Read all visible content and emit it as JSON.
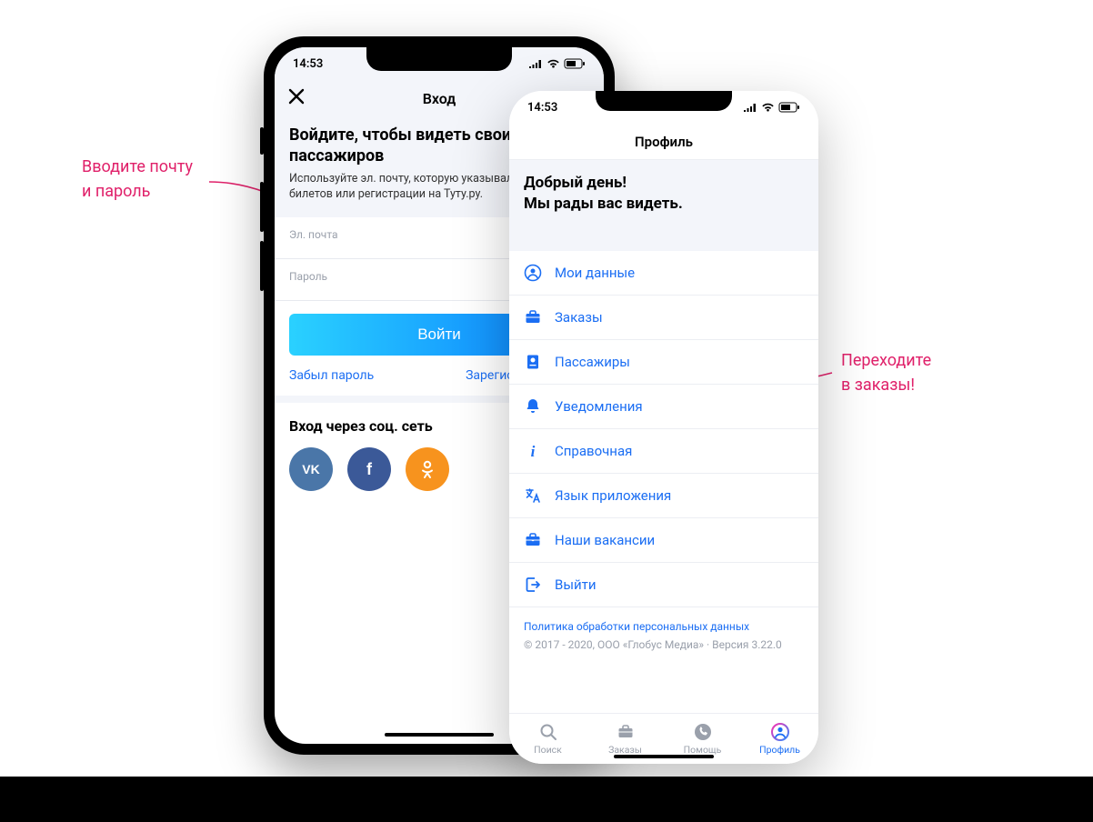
{
  "annotations": {
    "left_line1": "Вводите почту",
    "left_line2": "и пароль",
    "right_line1": "Переходите",
    "right_line2": "в заказы!"
  },
  "status": {
    "time": "14:53"
  },
  "login": {
    "nav_title": "Вход",
    "hero_title": "Войдите, чтобы видеть свои заказы и пассажиров",
    "hero_subtitle": "Используйте эл. почту, которую указывали при покупке билетов или регистрации на Туту.ру.",
    "fields": {
      "email_label": "Эл. почта",
      "password_label": "Пароль"
    },
    "login_button": "Войти",
    "forgot": "Забыл пароль",
    "register": "Зарегистрироваться",
    "social_title": "Вход через соц. сеть",
    "social": {
      "vk": "VK",
      "fb": "Facebook",
      "ok": "Odnoklassniki"
    }
  },
  "profile": {
    "nav_title": "Профиль",
    "greeting_line1": "Добрый день!",
    "greeting_line2": "Мы рады вас видеть.",
    "menu": [
      {
        "icon": "user-circle-icon",
        "label": "Мои данные"
      },
      {
        "icon": "briefcase-icon",
        "label": "Заказы"
      },
      {
        "icon": "passport-icon",
        "label": "Пассажиры"
      },
      {
        "icon": "bell-icon",
        "label": "Уведомления"
      },
      {
        "icon": "info-icon",
        "label": "Справочная"
      },
      {
        "icon": "translate-icon",
        "label": "Язык приложения"
      },
      {
        "icon": "briefcase2-icon",
        "label": "Наши вакансии"
      },
      {
        "icon": "logout-icon",
        "label": "Выйти"
      }
    ],
    "privacy_link": "Политика обработки персональных данных",
    "copyright": "© 2017 - 2020, ООО «Глобус Медиа» · Версия 3.22.0",
    "tabs": [
      {
        "icon": "search-icon",
        "label": "Поиск"
      },
      {
        "icon": "briefcase-icon",
        "label": "Заказы"
      },
      {
        "icon": "phone-icon",
        "label": "Помощь"
      },
      {
        "icon": "user-circle-icon",
        "label": "Профиль",
        "active": true
      }
    ]
  }
}
